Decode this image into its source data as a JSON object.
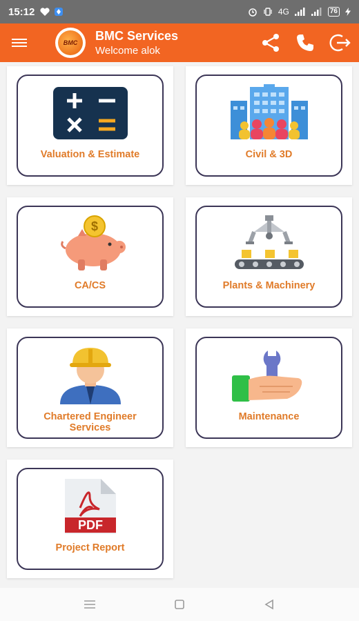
{
  "status_bar": {
    "time": "15:12",
    "network_type": "4G",
    "battery": "76"
  },
  "app_bar": {
    "logo_text": "BMC",
    "title": "BMC Services",
    "subtitle": "Welcome alok"
  },
  "services": [
    {
      "label": "Valuation & Estimate",
      "icon": "calculator-icon"
    },
    {
      "label": "Civil & 3D",
      "icon": "buildings-icon"
    },
    {
      "label": "CA/CS",
      "icon": "piggy-bank-icon"
    },
    {
      "label": "Plants & Machinery",
      "icon": "robotic-arm-icon"
    },
    {
      "label": "Chartered Engineer Services",
      "icon": "engineer-icon"
    },
    {
      "label": "Maintenance",
      "icon": "wrench-hand-icon"
    },
    {
      "label": "Project Report",
      "icon": "pdf-icon",
      "icon_text": "PDF"
    }
  ],
  "colors": {
    "primary": "#f26522",
    "label": "#e07b29",
    "card_border": "#3b3556"
  }
}
